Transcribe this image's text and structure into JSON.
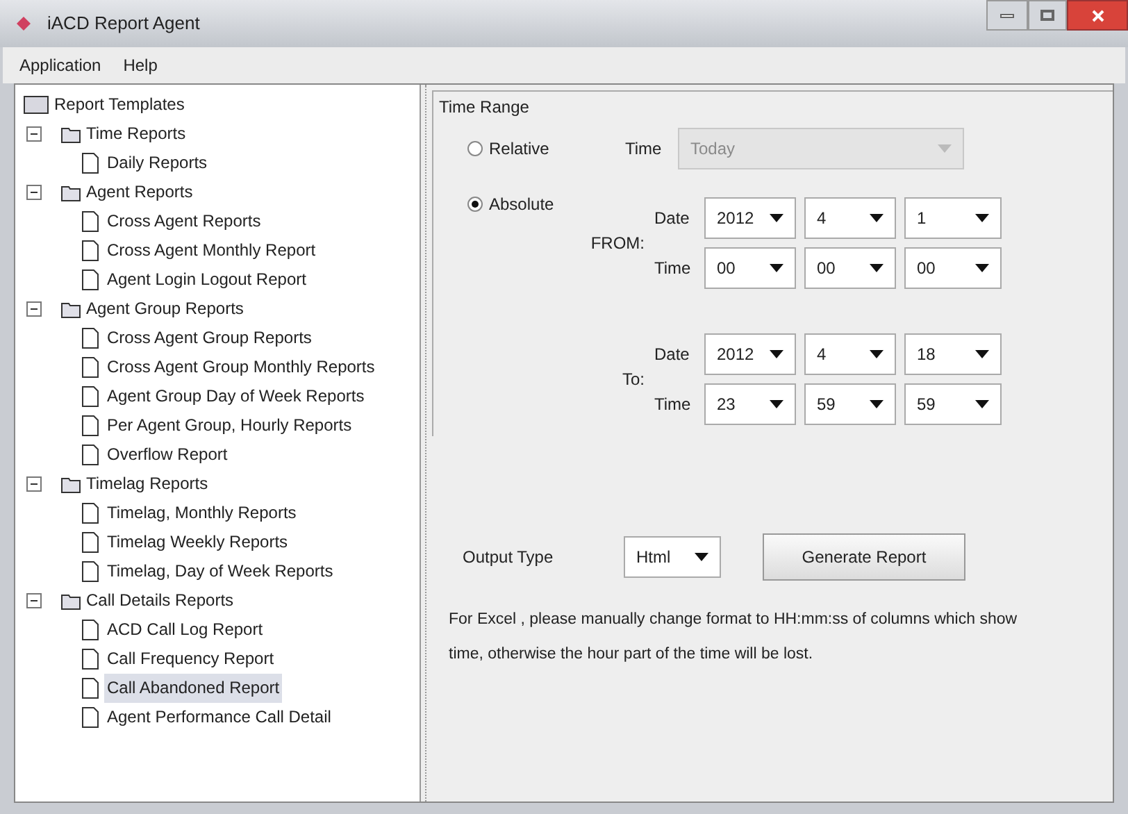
{
  "window": {
    "title": "iACD Report Agent"
  },
  "menu": [
    "Application",
    "Help"
  ],
  "tree": {
    "label": "Report Templates",
    "children": [
      {
        "label": "Time Reports",
        "expanded": true,
        "children": [
          {
            "label": "Daily Reports",
            "selected": false
          }
        ]
      },
      {
        "label": "Agent Reports",
        "expanded": true,
        "children": [
          {
            "label": "Cross Agent Reports",
            "selected": false
          },
          {
            "label": "Cross Agent Monthly Report",
            "selected": false
          },
          {
            "label": "Agent Login Logout Report",
            "selected": false
          }
        ]
      },
      {
        "label": "Agent Group Reports",
        "expanded": true,
        "children": [
          {
            "label": "Cross Agent Group Reports",
            "selected": false
          },
          {
            "label": "Cross Agent Group Monthly Reports",
            "selected": false
          },
          {
            "label": "Agent Group Day of Week Reports",
            "selected": false
          },
          {
            "label": "Per Agent Group, Hourly Reports",
            "selected": false
          },
          {
            "label": "Overflow Report",
            "selected": false
          }
        ]
      },
      {
        "label": "Timelag Reports",
        "expanded": true,
        "children": [
          {
            "label": "Timelag, Monthly Reports",
            "selected": false
          },
          {
            "label": "Timelag Weekly Reports",
            "selected": false
          },
          {
            "label": "Timelag, Day of Week Reports",
            "selected": false
          }
        ]
      },
      {
        "label": "Call Details Reports",
        "expanded": true,
        "children": [
          {
            "label": "ACD Call Log Report",
            "selected": false
          },
          {
            "label": "Call Frequency Report",
            "selected": false
          },
          {
            "label": "Call Abandoned Report",
            "selected": true
          },
          {
            "label": "Agent Performance Call Detail",
            "selected": false
          }
        ]
      }
    ]
  },
  "time_range": {
    "title": "Time Range",
    "relative": {
      "label": "Relative",
      "selected": false,
      "time_label": "Time",
      "time_value": "Today",
      "disabled": true
    },
    "absolute": {
      "label": "Absolute",
      "selected": true,
      "ranges": [
        {
          "label": "FROM:",
          "rows": [
            {
              "label": "Date",
              "values": [
                "2012",
                "4",
                "1"
              ]
            },
            {
              "label": "Time",
              "values": [
                "00",
                "00",
                "00"
              ]
            }
          ]
        },
        {
          "label": "To:",
          "rows": [
            {
              "label": "Date",
              "values": [
                "2012",
                "4",
                "18"
              ]
            },
            {
              "label": "Time",
              "values": [
                "23",
                "59",
                "59"
              ]
            }
          ]
        }
      ]
    }
  },
  "output": {
    "label": "Output Type",
    "value": "Html",
    "button": "Generate Report"
  },
  "note": [
    "For Excel , please manually change format to HH:mm:ss of columns which show",
    "time, otherwise the hour part of the time will be lost."
  ]
}
